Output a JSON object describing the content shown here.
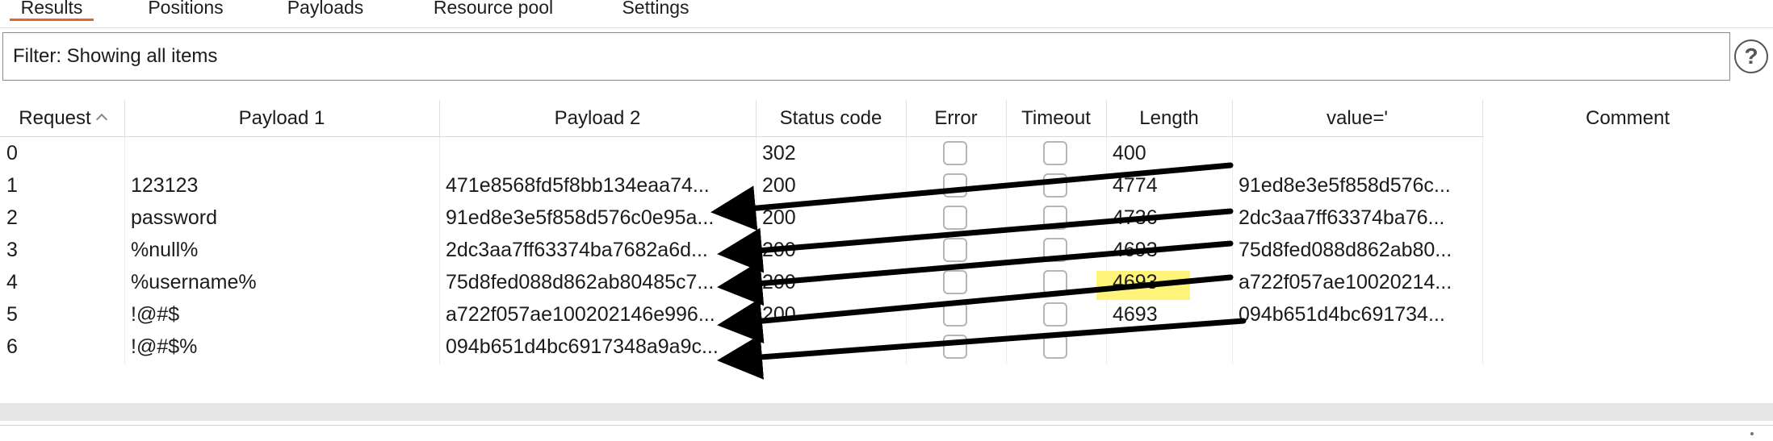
{
  "tabs": [
    {
      "label": "Results"
    },
    {
      "label": "Positions"
    },
    {
      "label": "Payloads"
    },
    {
      "label": "Resource pool"
    },
    {
      "label": "Settings"
    }
  ],
  "filter": {
    "text": "Filter: Showing all items"
  },
  "help": {
    "glyph": "?"
  },
  "columns": {
    "request": "Request",
    "payload1": "Payload 1",
    "payload2": "Payload 2",
    "status": "Status code",
    "error": "Error",
    "timeout": "Timeout",
    "length": "Length",
    "value": "value='",
    "comment": "Comment"
  },
  "rows": [
    {
      "request": "0",
      "payload1": "",
      "payload2": "",
      "status": "302",
      "length": "400",
      "value": ""
    },
    {
      "request": "1",
      "payload1": "123123",
      "payload2": "471e8568fd5f8bb134eaa74...",
      "status": "200",
      "length": "4774",
      "value": "91ed8e3e5f858d576c..."
    },
    {
      "request": "2",
      "payload1": "password",
      "payload2": "91ed8e3e5f858d576c0e95a...",
      "status": "200",
      "length": "4736",
      "value": "2dc3aa7ff63374ba76..."
    },
    {
      "request": "3",
      "payload1": "%null%",
      "payload2": "2dc3aa7ff63374ba7682a6d...",
      "status": "200",
      "length": "4693",
      "value": "75d8fed088d862ab80..."
    },
    {
      "request": "4",
      "payload1": "%username%",
      "payload2": "75d8fed088d862ab80485c7...",
      "status": "200",
      "length": "4693",
      "value": "a722f057ae10020214..."
    },
    {
      "request": "5",
      "payload1": "!@#$",
      "payload2": "a722f057ae100202146e996...",
      "status": "200",
      "length": "4693",
      "value": "094b651d4bc691734..."
    },
    {
      "request": "6",
      "payload1": "!@#$%",
      "payload2": "094b651d4bc6917348a9a9c...",
      "status": "",
      "length": "",
      "value": ""
    }
  ],
  "highlight_color": "#fff37a",
  "accent_color": "#e8632d",
  "annotation": {
    "arrow_count": 6,
    "arrow_color": "#000000"
  }
}
